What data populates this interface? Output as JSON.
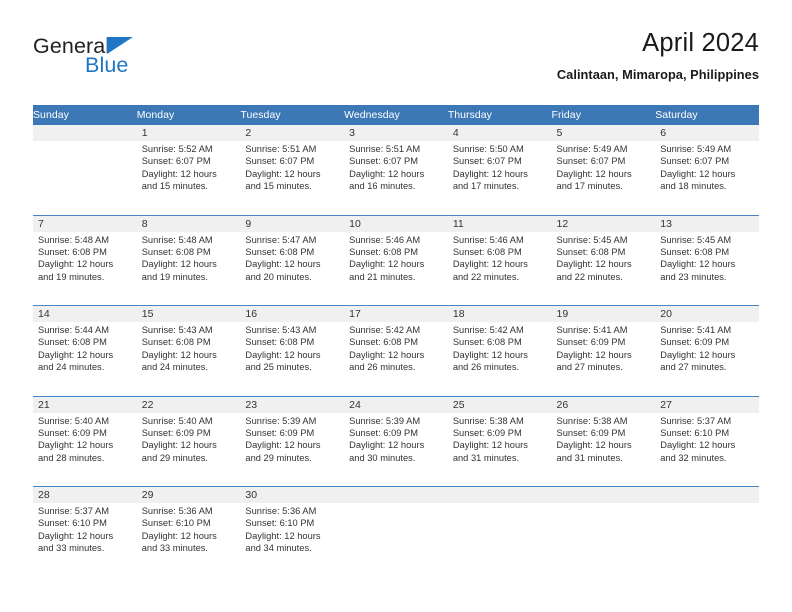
{
  "brand": {
    "name_part1": "General",
    "name_part2": "Blue",
    "triangle_color": "#1f76c4",
    "text_color": "#231f20"
  },
  "header": {
    "title": "April 2024",
    "subtitle": "Calintaan, Mimaropa, Philippines"
  },
  "theme": {
    "header_bg": "#3d78b6",
    "header_text": "#ffffff",
    "daynum_bg": "#f0f0f0",
    "separator": "#4a86c5",
    "body_text": "#333333"
  },
  "weekday_headers": [
    "Sunday",
    "Monday",
    "Tuesday",
    "Wednesday",
    "Thursday",
    "Friday",
    "Saturday"
  ],
  "weeks": [
    {
      "days": [
        {
          "num": "",
          "sunrise": "",
          "sunset": "",
          "daylight_1": "",
          "daylight_2": ""
        },
        {
          "num": "1",
          "sunrise": "Sunrise: 5:52 AM",
          "sunset": "Sunset: 6:07 PM",
          "daylight_1": "Daylight: 12 hours",
          "daylight_2": "and 15 minutes."
        },
        {
          "num": "2",
          "sunrise": "Sunrise: 5:51 AM",
          "sunset": "Sunset: 6:07 PM",
          "daylight_1": "Daylight: 12 hours",
          "daylight_2": "and 15 minutes."
        },
        {
          "num": "3",
          "sunrise": "Sunrise: 5:51 AM",
          "sunset": "Sunset: 6:07 PM",
          "daylight_1": "Daylight: 12 hours",
          "daylight_2": "and 16 minutes."
        },
        {
          "num": "4",
          "sunrise": "Sunrise: 5:50 AM",
          "sunset": "Sunset: 6:07 PM",
          "daylight_1": "Daylight: 12 hours",
          "daylight_2": "and 17 minutes."
        },
        {
          "num": "5",
          "sunrise": "Sunrise: 5:49 AM",
          "sunset": "Sunset: 6:07 PM",
          "daylight_1": "Daylight: 12 hours",
          "daylight_2": "and 17 minutes."
        },
        {
          "num": "6",
          "sunrise": "Sunrise: 5:49 AM",
          "sunset": "Sunset: 6:07 PM",
          "daylight_1": "Daylight: 12 hours",
          "daylight_2": "and 18 minutes."
        }
      ]
    },
    {
      "days": [
        {
          "num": "7",
          "sunrise": "Sunrise: 5:48 AM",
          "sunset": "Sunset: 6:08 PM",
          "daylight_1": "Daylight: 12 hours",
          "daylight_2": "and 19 minutes."
        },
        {
          "num": "8",
          "sunrise": "Sunrise: 5:48 AM",
          "sunset": "Sunset: 6:08 PM",
          "daylight_1": "Daylight: 12 hours",
          "daylight_2": "and 19 minutes."
        },
        {
          "num": "9",
          "sunrise": "Sunrise: 5:47 AM",
          "sunset": "Sunset: 6:08 PM",
          "daylight_1": "Daylight: 12 hours",
          "daylight_2": "and 20 minutes."
        },
        {
          "num": "10",
          "sunrise": "Sunrise: 5:46 AM",
          "sunset": "Sunset: 6:08 PM",
          "daylight_1": "Daylight: 12 hours",
          "daylight_2": "and 21 minutes."
        },
        {
          "num": "11",
          "sunrise": "Sunrise: 5:46 AM",
          "sunset": "Sunset: 6:08 PM",
          "daylight_1": "Daylight: 12 hours",
          "daylight_2": "and 22 minutes."
        },
        {
          "num": "12",
          "sunrise": "Sunrise: 5:45 AM",
          "sunset": "Sunset: 6:08 PM",
          "daylight_1": "Daylight: 12 hours",
          "daylight_2": "and 22 minutes."
        },
        {
          "num": "13",
          "sunrise": "Sunrise: 5:45 AM",
          "sunset": "Sunset: 6:08 PM",
          "daylight_1": "Daylight: 12 hours",
          "daylight_2": "and 23 minutes."
        }
      ]
    },
    {
      "days": [
        {
          "num": "14",
          "sunrise": "Sunrise: 5:44 AM",
          "sunset": "Sunset: 6:08 PM",
          "daylight_1": "Daylight: 12 hours",
          "daylight_2": "and 24 minutes."
        },
        {
          "num": "15",
          "sunrise": "Sunrise: 5:43 AM",
          "sunset": "Sunset: 6:08 PM",
          "daylight_1": "Daylight: 12 hours",
          "daylight_2": "and 24 minutes."
        },
        {
          "num": "16",
          "sunrise": "Sunrise: 5:43 AM",
          "sunset": "Sunset: 6:08 PM",
          "daylight_1": "Daylight: 12 hours",
          "daylight_2": "and 25 minutes."
        },
        {
          "num": "17",
          "sunrise": "Sunrise: 5:42 AM",
          "sunset": "Sunset: 6:08 PM",
          "daylight_1": "Daylight: 12 hours",
          "daylight_2": "and 26 minutes."
        },
        {
          "num": "18",
          "sunrise": "Sunrise: 5:42 AM",
          "sunset": "Sunset: 6:08 PM",
          "daylight_1": "Daylight: 12 hours",
          "daylight_2": "and 26 minutes."
        },
        {
          "num": "19",
          "sunrise": "Sunrise: 5:41 AM",
          "sunset": "Sunset: 6:09 PM",
          "daylight_1": "Daylight: 12 hours",
          "daylight_2": "and 27 minutes."
        },
        {
          "num": "20",
          "sunrise": "Sunrise: 5:41 AM",
          "sunset": "Sunset: 6:09 PM",
          "daylight_1": "Daylight: 12 hours",
          "daylight_2": "and 27 minutes."
        }
      ]
    },
    {
      "days": [
        {
          "num": "21",
          "sunrise": "Sunrise: 5:40 AM",
          "sunset": "Sunset: 6:09 PM",
          "daylight_1": "Daylight: 12 hours",
          "daylight_2": "and 28 minutes."
        },
        {
          "num": "22",
          "sunrise": "Sunrise: 5:40 AM",
          "sunset": "Sunset: 6:09 PM",
          "daylight_1": "Daylight: 12 hours",
          "daylight_2": "and 29 minutes."
        },
        {
          "num": "23",
          "sunrise": "Sunrise: 5:39 AM",
          "sunset": "Sunset: 6:09 PM",
          "daylight_1": "Daylight: 12 hours",
          "daylight_2": "and 29 minutes."
        },
        {
          "num": "24",
          "sunrise": "Sunrise: 5:39 AM",
          "sunset": "Sunset: 6:09 PM",
          "daylight_1": "Daylight: 12 hours",
          "daylight_2": "and 30 minutes."
        },
        {
          "num": "25",
          "sunrise": "Sunrise: 5:38 AM",
          "sunset": "Sunset: 6:09 PM",
          "daylight_1": "Daylight: 12 hours",
          "daylight_2": "and 31 minutes."
        },
        {
          "num": "26",
          "sunrise": "Sunrise: 5:38 AM",
          "sunset": "Sunset: 6:09 PM",
          "daylight_1": "Daylight: 12 hours",
          "daylight_2": "and 31 minutes."
        },
        {
          "num": "27",
          "sunrise": "Sunrise: 5:37 AM",
          "sunset": "Sunset: 6:10 PM",
          "daylight_1": "Daylight: 12 hours",
          "daylight_2": "and 32 minutes."
        }
      ]
    },
    {
      "days": [
        {
          "num": "28",
          "sunrise": "Sunrise: 5:37 AM",
          "sunset": "Sunset: 6:10 PM",
          "daylight_1": "Daylight: 12 hours",
          "daylight_2": "and 33 minutes."
        },
        {
          "num": "29",
          "sunrise": "Sunrise: 5:36 AM",
          "sunset": "Sunset: 6:10 PM",
          "daylight_1": "Daylight: 12 hours",
          "daylight_2": "and 33 minutes."
        },
        {
          "num": "30",
          "sunrise": "Sunrise: 5:36 AM",
          "sunset": "Sunset: 6:10 PM",
          "daylight_1": "Daylight: 12 hours",
          "daylight_2": "and 34 minutes."
        },
        {
          "num": "",
          "sunrise": "",
          "sunset": "",
          "daylight_1": "",
          "daylight_2": ""
        },
        {
          "num": "",
          "sunrise": "",
          "sunset": "",
          "daylight_1": "",
          "daylight_2": ""
        },
        {
          "num": "",
          "sunrise": "",
          "sunset": "",
          "daylight_1": "",
          "daylight_2": ""
        },
        {
          "num": "",
          "sunrise": "",
          "sunset": "",
          "daylight_1": "",
          "daylight_2": ""
        }
      ]
    }
  ]
}
